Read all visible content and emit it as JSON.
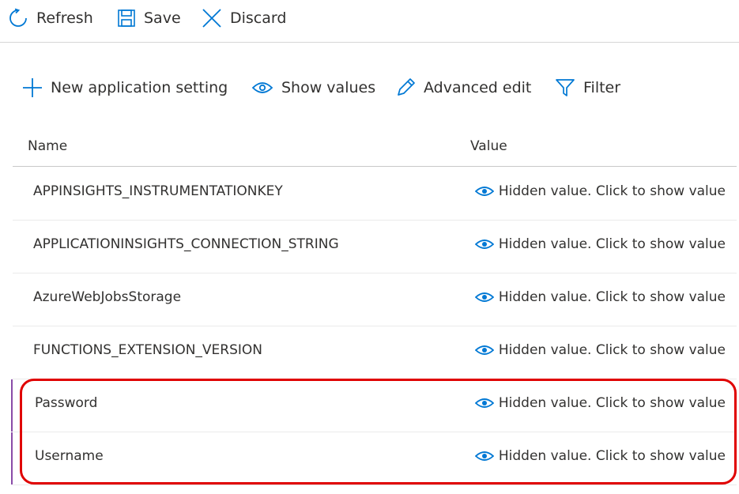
{
  "commandbar": {
    "refresh_label": "Refresh",
    "save_label": "Save",
    "discard_label": "Discard"
  },
  "toolbar": {
    "new_label": "New application setting",
    "show_values_label": "Show values",
    "advanced_edit_label": "Advanced edit",
    "filter_label": "Filter"
  },
  "table": {
    "columns": [
      "Name",
      "Value"
    ],
    "rows": [
      {
        "name": "APPINSIGHTS_INSTRUMENTATIONKEY",
        "value": "Hidden value. Click to show value"
      },
      {
        "name": "APPLICATIONINSIGHTS_CONNECTION_STRING",
        "value": "Hidden value. Click to show value"
      },
      {
        "name": "AzureWebJobsStorage",
        "value": "Hidden value. Click to show value"
      },
      {
        "name": "FUNCTIONS_EXTENSION_VERSION",
        "value": "Hidden value. Click to show value"
      },
      {
        "name": "Password",
        "value": "Hidden value. Click to show value"
      },
      {
        "name": "Username",
        "value": "Hidden value. Click to show value"
      }
    ]
  },
  "colors": {
    "icon_blue": "#0078d4",
    "highlight_red": "#e00000",
    "new_marker": "#8a4ca8"
  },
  "icons": {
    "refresh": "refresh-icon",
    "save": "save-icon",
    "discard": "close-icon",
    "new": "plus-icon",
    "show": "eye-icon",
    "edit": "pencil-icon",
    "filter": "filter-icon"
  }
}
